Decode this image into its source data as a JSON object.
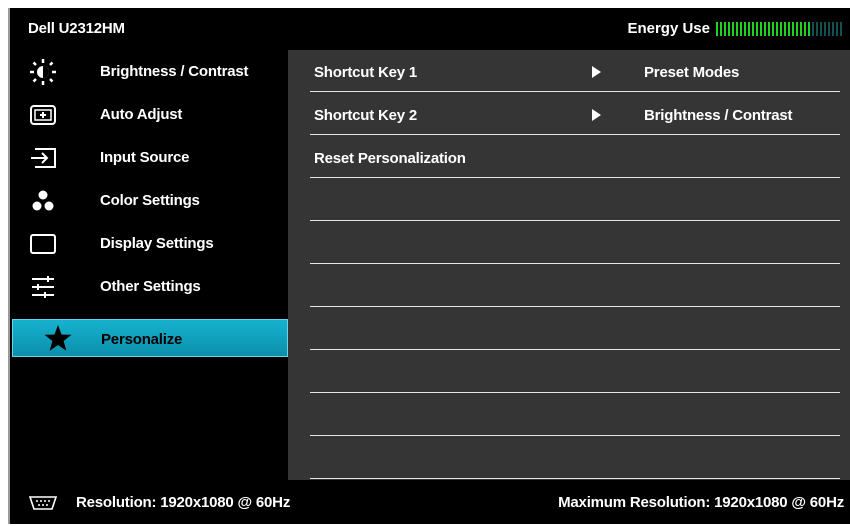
{
  "header": {
    "model": "Dell U2312HM",
    "energy_label": "Energy Use",
    "energy_level": 0.75
  },
  "sidebar": {
    "items": [
      {
        "label": "Brightness / Contrast",
        "icon": "brightness-icon"
      },
      {
        "label": "Auto Adjust",
        "icon": "auto-adjust-icon"
      },
      {
        "label": "Input Source",
        "icon": "input-source-icon"
      },
      {
        "label": "Color Settings",
        "icon": "color-settings-icon"
      },
      {
        "label": "Display Settings",
        "icon": "display-settings-icon"
      },
      {
        "label": "Other Settings",
        "icon": "other-settings-icon"
      },
      {
        "label": "Personalize",
        "icon": "star-icon",
        "selected": true
      }
    ]
  },
  "panel": {
    "rows": [
      {
        "label": "Shortcut Key 1",
        "value": "Preset Modes"
      },
      {
        "label": "Shortcut Key 2",
        "value": "Brightness / Contrast"
      },
      {
        "label": "Reset Personalization",
        "value": ""
      }
    ]
  },
  "footer": {
    "resolution": "Resolution: 1920x1080 @ 60Hz",
    "max_resolution": "Maximum Resolution: 1920x1080 @ 60Hz"
  },
  "colors": {
    "highlight": "#12a6c3",
    "panel_bg": "#353535",
    "energy_on": "#21d321"
  }
}
